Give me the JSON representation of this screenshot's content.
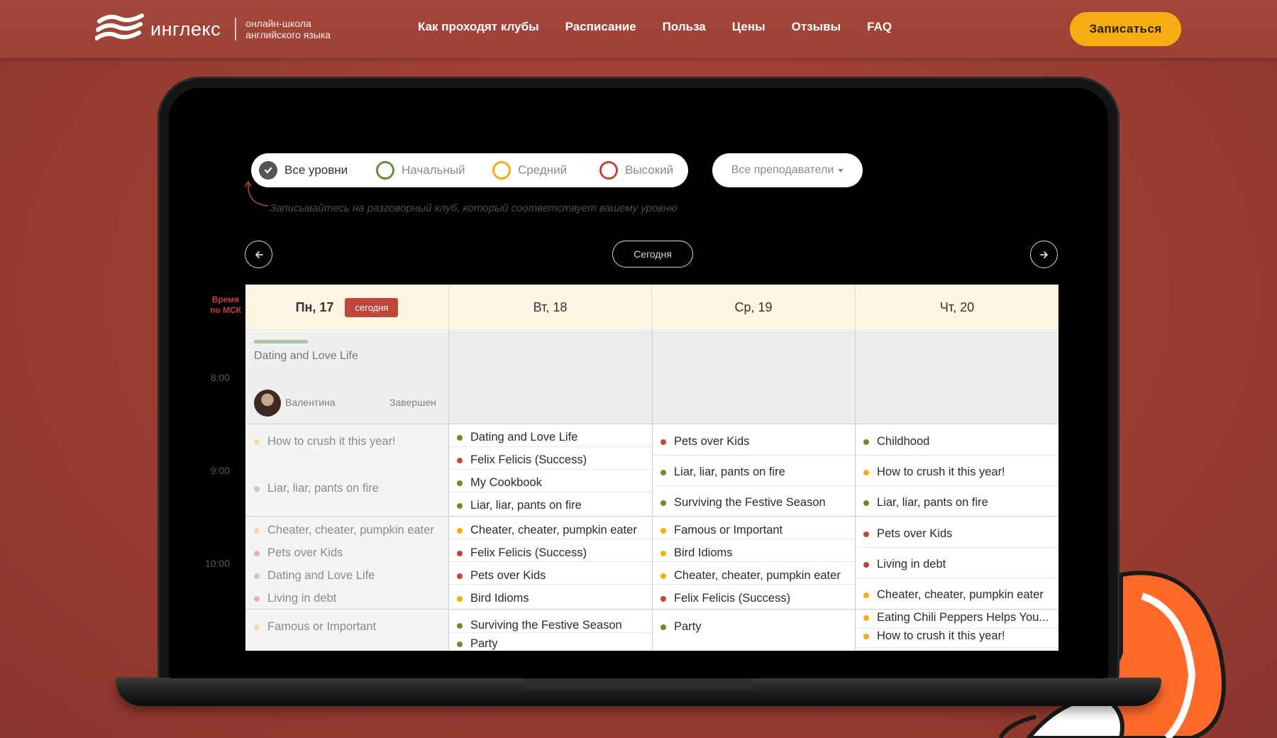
{
  "header": {
    "brand": "инглекс",
    "tagline_line1": "онлайн-школа",
    "tagline_line2": "английского языка",
    "nav": [
      "Как проходят клубы",
      "Расписание",
      "Польза",
      "Цены",
      "Отзывы",
      "FAQ"
    ],
    "cta": "Записаться"
  },
  "filters": {
    "levels": [
      {
        "label": "Все уровни",
        "active": true,
        "color": "#555555"
      },
      {
        "label": "Начальный",
        "active": false,
        "color": "#6e8a2e"
      },
      {
        "label": "Средний",
        "active": false,
        "color": "#f6ad12"
      },
      {
        "label": "Высокий",
        "active": false,
        "color": "#c0463a"
      }
    ],
    "teachers": "Все преподаватели",
    "hint": "Записывайтесь на разговорный клуб, который соответствует вашему уровню"
  },
  "navigation": {
    "today": "Сегодня",
    "prev_icon": "arrow-left-icon",
    "next_icon": "arrow-right-icon"
  },
  "calendar": {
    "time_caption_line1": "Время",
    "time_caption_line2": "по МСК",
    "times": [
      "8:00",
      "9:00",
      "10:00"
    ],
    "today_badge": "сегодня",
    "days": [
      {
        "label": "Пн, 17",
        "today": true
      },
      {
        "label": "Вт, 18",
        "today": false
      },
      {
        "label": "Ср, 19",
        "today": false
      },
      {
        "label": "Чт, 20",
        "today": false
      }
    ],
    "event": {
      "title": "Dating and Love Life",
      "teacher": "Валентина",
      "status": "Завершен"
    },
    "colors": {
      "beginner": "#6e8a2e",
      "intermediate": "#f6ad12",
      "advanced": "#c0463a"
    },
    "clubs": [
      [
        {
          "title": "How to crush it this year!",
          "level": "intermediate",
          "muted": true
        },
        {
          "title": "Liar, liar, pants on fire",
          "level": "beginner",
          "muted": true
        },
        {
          "title": "Cheater, cheater, pumpkin eater",
          "level": "intermediate",
          "muted": true
        },
        {
          "title": "Pets over Kids",
          "level": "advanced",
          "muted": true
        },
        {
          "title": "Dating and Love Life",
          "level": "beginner",
          "muted": true
        },
        {
          "title": "Living in debt",
          "level": "advanced",
          "muted": true
        },
        {
          "title": "Famous or Important",
          "level": "intermediate",
          "muted": true
        }
      ],
      [
        {
          "title": "Dating and Love Life",
          "level": "beginner"
        },
        {
          "title": "Felix Felicis (Success)",
          "level": "advanced"
        },
        {
          "title": "My Cookbook",
          "level": "beginner"
        },
        {
          "title": "Liar, liar, pants on fire",
          "level": "beginner"
        },
        {
          "title": "Cheater, cheater, pumpkin eater",
          "level": "intermediate"
        },
        {
          "title": "Felix Felicis (Success)",
          "level": "advanced"
        },
        {
          "title": "Pets over Kids",
          "level": "advanced"
        },
        {
          "title": "Bird Idioms",
          "level": "intermediate"
        },
        {
          "title": "Surviving the Festive Season",
          "level": "beginner"
        },
        {
          "title": "Party",
          "level": "beginner"
        }
      ],
      [
        {
          "title": "Pets over Kids",
          "level": "advanced"
        },
        {
          "title": "Liar, liar, pants on fire",
          "level": "beginner"
        },
        {
          "title": "Surviving the Festive Season",
          "level": "beginner"
        },
        {
          "title": "Famous or Important",
          "level": "intermediate"
        },
        {
          "title": "Bird Idioms",
          "level": "intermediate"
        },
        {
          "title": "Cheater, cheater, pumpkin eater",
          "level": "intermediate"
        },
        {
          "title": "Felix Felicis (Success)",
          "level": "advanced"
        },
        {
          "title": "Party",
          "level": "beginner"
        }
      ],
      [
        {
          "title": "Childhood",
          "level": "beginner"
        },
        {
          "title": "How to crush it this year!",
          "level": "intermediate"
        },
        {
          "title": "Liar, liar, pants on fire",
          "level": "beginner"
        },
        {
          "title": "Pets over Kids",
          "level": "advanced"
        },
        {
          "title": "Living in debt",
          "level": "advanced"
        },
        {
          "title": "Cheater, cheater, pumpkin eater",
          "level": "intermediate"
        },
        {
          "title": "Eating Chili Peppers Helps You...",
          "level": "intermediate"
        },
        {
          "title": "How to crush it this year!",
          "level": "intermediate"
        }
      ]
    ]
  }
}
